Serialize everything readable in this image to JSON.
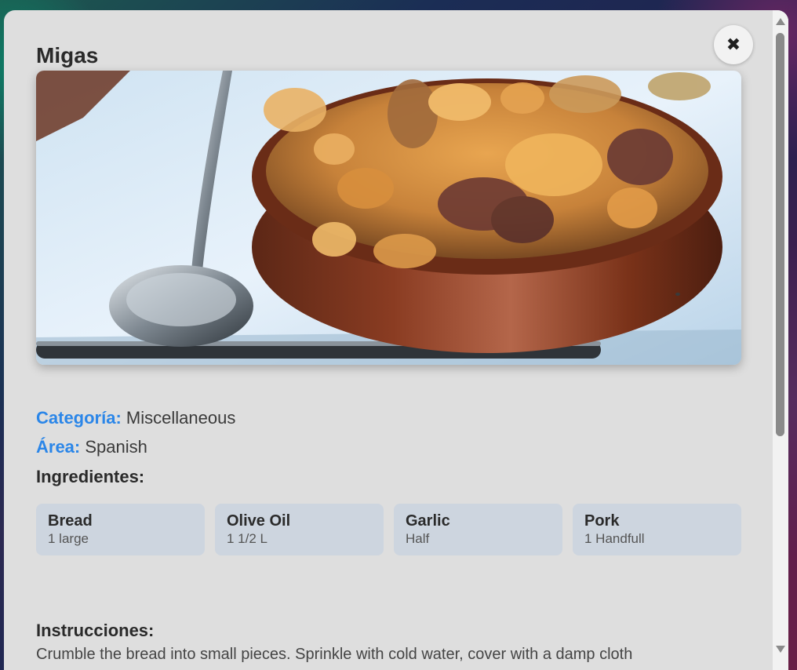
{
  "recipe": {
    "title": "Migas",
    "image_alt": "Migas",
    "category_label": "Categoría:",
    "category_value": "Miscellaneous",
    "area_label": "Área:",
    "area_value": "Spanish"
  },
  "ingredients_section": {
    "heading": "Ingredientes:",
    "items": [
      {
        "name": "Bread",
        "measure": "1 large"
      },
      {
        "name": "Olive Oil",
        "measure": "1 1/2 L"
      },
      {
        "name": "Garlic",
        "measure": "Half"
      },
      {
        "name": "Pork",
        "measure": "1 Handfull"
      }
    ]
  },
  "instructions_section": {
    "heading": "Instrucciones:",
    "text": "Crumble the bread into small pieces. Sprinkle with cold water, cover with a damp cloth"
  },
  "icons": {
    "close": "close-icon",
    "scroll_up": "arrow-up-icon",
    "scroll_down": "arrow-down-icon"
  },
  "colors": {
    "accent": "#2b86e8",
    "modal_background": "#dedede",
    "card_background": "#cdd5df"
  }
}
